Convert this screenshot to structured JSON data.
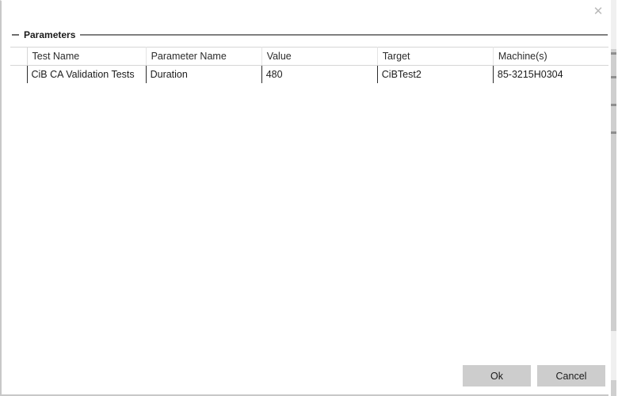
{
  "window": {
    "close_label": "✕"
  },
  "group": {
    "title": "Parameters",
    "toggle_icon": "minus-icon"
  },
  "grid": {
    "columns": [
      "Test Name",
      "Parameter Name",
      "Value",
      "Target",
      "Machine(s)"
    ],
    "rows": [
      {
        "test_name": "CiB CA Validation Tests",
        "parameter_name": "Duration",
        "value": "480",
        "target": "CiBTest2",
        "machines": "85-3215H0304"
      }
    ]
  },
  "footer": {
    "ok_label": "Ok",
    "cancel_label": "Cancel"
  },
  "colors": {
    "button_face": "#cdcdcd",
    "group_rule": "#808080",
    "grid_line": "#d6d6d6",
    "cell_separator": "#2c2c2c",
    "close_glyph": "#b9b9b9"
  }
}
